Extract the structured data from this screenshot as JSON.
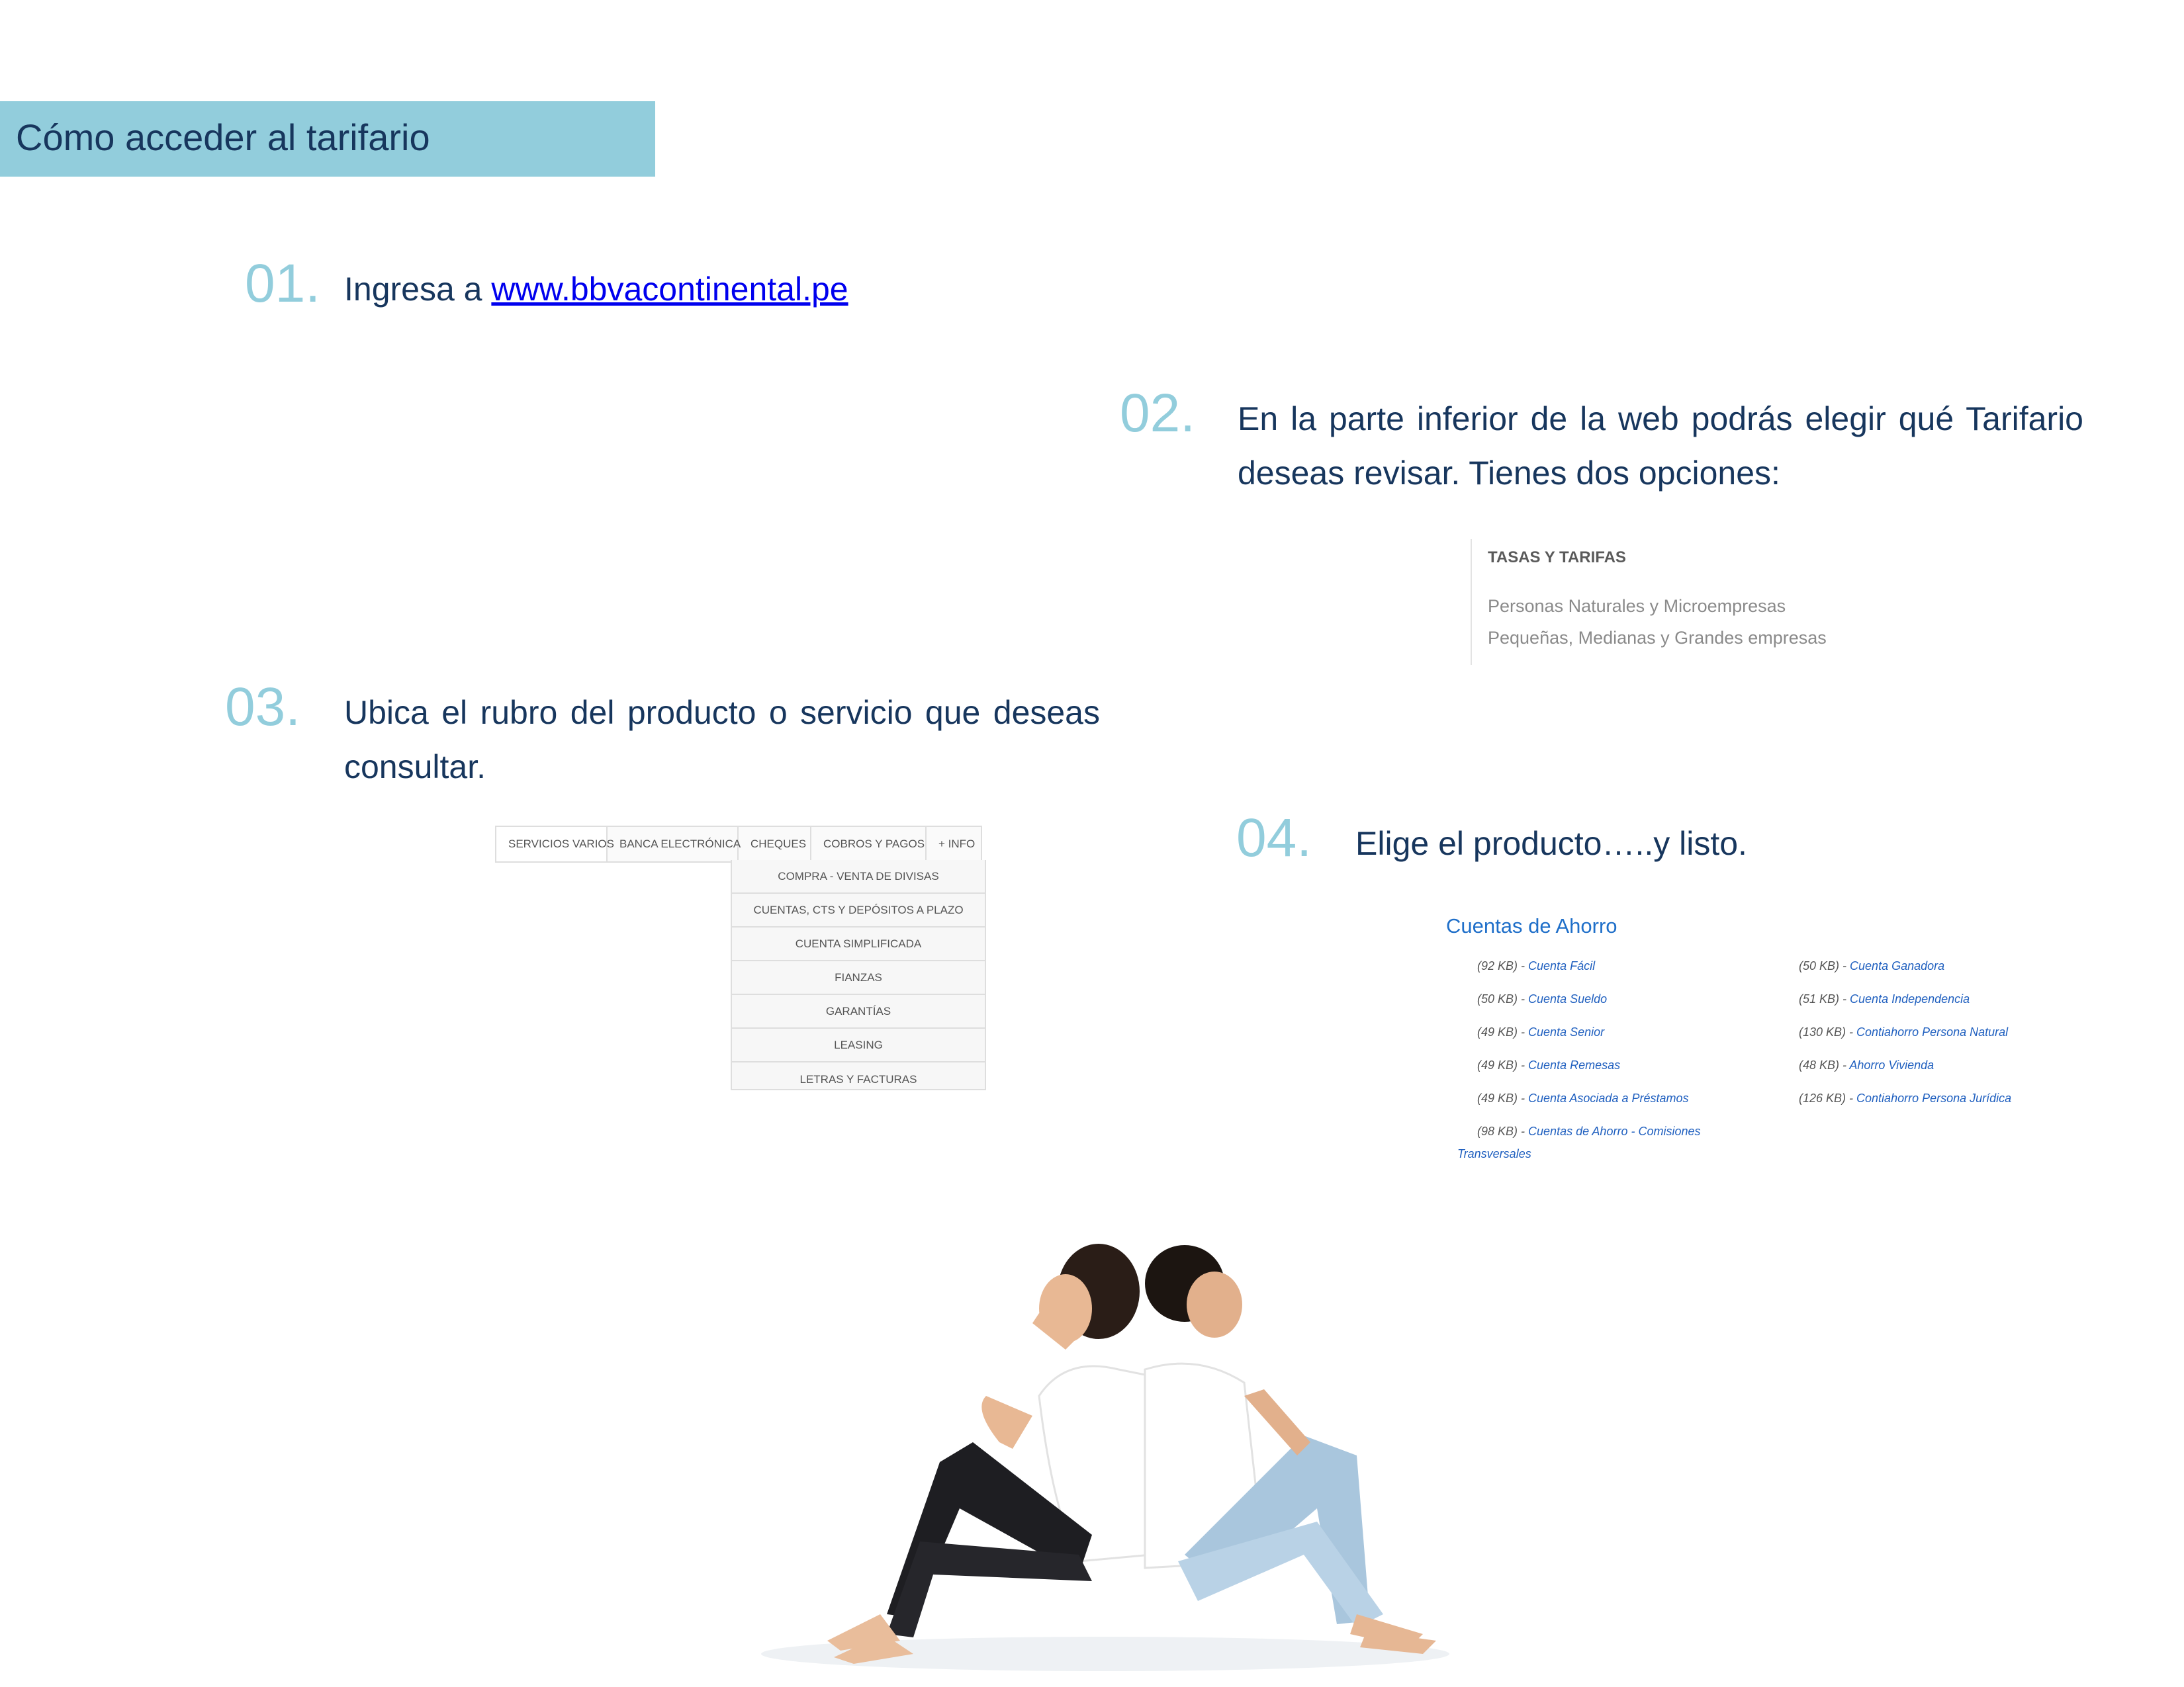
{
  "header": {
    "title": "Cómo acceder al tarifario"
  },
  "steps": {
    "s1": {
      "num": "01.",
      "text": "Ingresa a ",
      "link": "www.bbvacontinental.pe"
    },
    "s2": {
      "num": "02.",
      "text": "En la parte inferior de la web podrás elegir qué Tarifario deseas revisar. Tienes dos opciones:"
    },
    "s3": {
      "num": "03.",
      "text": "Ubica el rubro del producto o servicio que deseas consultar."
    },
    "s4": {
      "num": "04.",
      "text": "Elige el producto…..y listo."
    }
  },
  "rates_menu": {
    "title": "TASAS Y TARIFAS",
    "options": [
      "Personas Naturales y Microempresas",
      "Pequeñas, Medianas y Grandes empresas"
    ]
  },
  "category_tabs": {
    "tabs": [
      "SERVICIOS VARIOS",
      "BANCA ELECTRÓNICA",
      "CHEQUES",
      "COBROS Y PAGOS",
      "+ INFO"
    ],
    "dropdown": [
      "COMPRA - VENTA DE DIVISAS",
      "CUENTAS, CTS Y DEPÓSITOS A PLAZO",
      "CUENTA SIMPLIFICADA",
      "FIANZAS",
      "GARANTÍAS",
      "LEASING",
      "LETRAS Y FACTURAS"
    ]
  },
  "savings": {
    "title": "Cuentas de Ahorro",
    "left": [
      {
        "size": "(92 KB) - ",
        "name": "Cuenta Fácil"
      },
      {
        "size": "(50 KB) - ",
        "name": "Cuenta Sueldo"
      },
      {
        "size": "(49 KB) - ",
        "name": "Cuenta Senior"
      },
      {
        "size": "(49 KB) - ",
        "name": "Cuenta Remesas"
      },
      {
        "size": "(49 KB) - ",
        "name": "Cuenta Asociada a Préstamos"
      },
      {
        "size": "(98 KB) - ",
        "name": "Cuentas de Ahorro - Comisiones",
        "cont": "Transversales"
      }
    ],
    "right": [
      {
        "size": "(50 KB) - ",
        "name": "Cuenta Ganadora"
      },
      {
        "size": "(51 KB) - ",
        "name": "Cuenta Independencia"
      },
      {
        "size": "(130 KB) - ",
        "name": "Contiahorro Persona Natural"
      },
      {
        "size": "(48 KB) - ",
        "name": "Ahorro Vivienda"
      },
      {
        "size": "(126 KB) - ",
        "name": "Contiahorro Persona Jurídica"
      }
    ]
  },
  "colors": {
    "accent": "#92cddc",
    "text": "#17365d",
    "link": "#0000ee",
    "savings_link": "#1f5fbf"
  }
}
